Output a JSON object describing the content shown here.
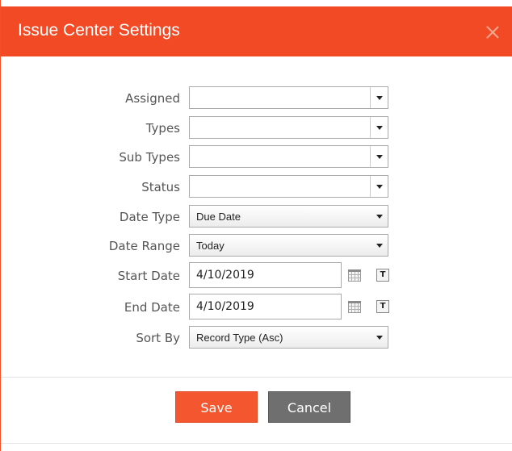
{
  "dialog": {
    "title": "Issue Center Settings",
    "accent_color": "#f34a26",
    "close_icon": "close-icon"
  },
  "fields": {
    "assigned": {
      "label": "Assigned",
      "value": ""
    },
    "types": {
      "label": "Types",
      "value": ""
    },
    "sub_types": {
      "label": "Sub Types",
      "value": ""
    },
    "status": {
      "label": "Status",
      "value": ""
    },
    "date_type": {
      "label": "Date Type",
      "value": "Due Date"
    },
    "date_range": {
      "label": "Date Range",
      "value": "Today"
    },
    "start_date": {
      "label": "Start Date",
      "value": "4/10/2019",
      "today_button": "T"
    },
    "end_date": {
      "label": "End Date",
      "value": "4/10/2019",
      "today_button": "T"
    },
    "sort_by": {
      "label": "Sort By",
      "value": "Record Type (Asc)"
    }
  },
  "buttons": {
    "save": "Save",
    "cancel": "Cancel"
  }
}
